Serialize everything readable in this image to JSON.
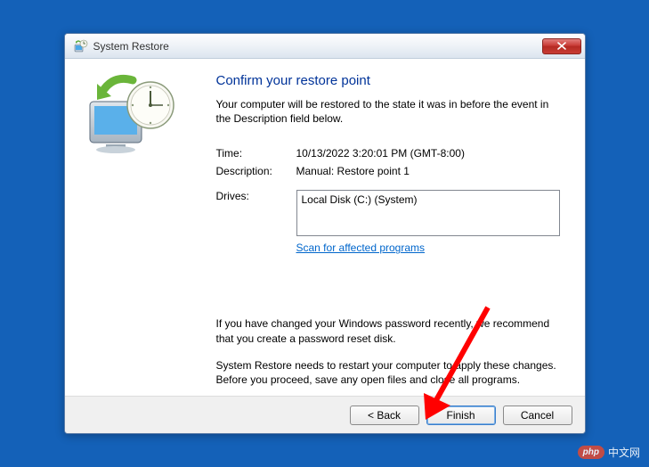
{
  "window": {
    "title": "System Restore"
  },
  "content": {
    "heading": "Confirm your restore point",
    "intro": "Your computer will be restored to the state it was in before the event in the Description field below.",
    "fields": {
      "time_label": "Time:",
      "time_value": "10/13/2022 3:20:01 PM (GMT-8:00)",
      "description_label": "Description:",
      "description_value": "Manual: Restore point 1",
      "drives_label": "Drives:",
      "drives_value": "Local Disk (C:) (System)"
    },
    "scan_link": "Scan for affected programs",
    "note1": "If you have changed your Windows password recently, we recommend that you create a password reset disk.",
    "note2": "System Restore needs to restart your computer to apply these changes. Before you proceed, save any open files and close all programs."
  },
  "footer": {
    "back": "< Back",
    "finish": "Finish",
    "cancel": "Cancel"
  },
  "watermark": {
    "badge": "php",
    "text": "中文网"
  }
}
